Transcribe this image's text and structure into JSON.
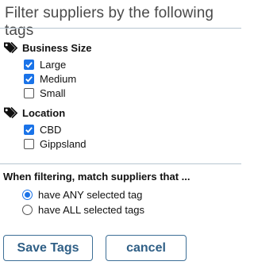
{
  "title": "Filter suppliers by the following tags",
  "groups": [
    {
      "icon": "tags-icon",
      "label": "Business Size",
      "options": [
        {
          "label": "Large",
          "checked": true
        },
        {
          "label": "Medium",
          "checked": true
        },
        {
          "label": "Small",
          "checked": false
        }
      ]
    },
    {
      "icon": "tags-icon",
      "label": "Location",
      "options": [
        {
          "label": "CBD",
          "checked": true
        },
        {
          "label": "Gippsland",
          "checked": false
        }
      ]
    }
  ],
  "match": {
    "label": "When filtering, match suppliers that ...",
    "options": [
      {
        "label": "have ANY selected tag",
        "selected": true
      },
      {
        "label": "have ALL selected tags",
        "selected": false
      }
    ]
  },
  "buttons": {
    "save": "Save Tags",
    "cancel": "cancel"
  },
  "colors": {
    "accent": "#1a73e8",
    "button_text": "#2f5f86",
    "button_border": "#3d6f96",
    "title": "#4a4a4a"
  }
}
